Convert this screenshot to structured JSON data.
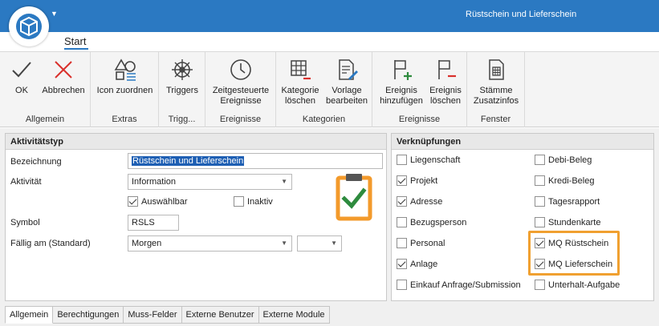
{
  "window": {
    "title": "Rüstschein und Lieferschein"
  },
  "ribbon": {
    "tab": "Start",
    "groups": [
      {
        "label": "Allgemein",
        "buttons": [
          {
            "label": "OK"
          },
          {
            "label": "Abbrechen"
          }
        ]
      },
      {
        "label": "Extras",
        "buttons": [
          {
            "label": "Icon zuordnen"
          }
        ]
      },
      {
        "label": "Trigg...",
        "buttons": [
          {
            "label": "Triggers"
          }
        ]
      },
      {
        "label": "Ereignisse",
        "buttons": [
          {
            "label1": "Zeitgesteuerte",
            "label2": "Ereignisse"
          }
        ]
      },
      {
        "label": "Kategorien",
        "buttons": [
          {
            "label1": "Kategorie",
            "label2": "löschen"
          },
          {
            "label1": "Vorlage",
            "label2": "bearbeiten"
          }
        ]
      },
      {
        "label": "Ereignisse",
        "buttons": [
          {
            "label1": "Ereignis",
            "label2": "hinzufügen"
          },
          {
            "label1": "Ereignis",
            "label2": "löschen"
          }
        ]
      },
      {
        "label": "Fenster",
        "buttons": [
          {
            "label1": "Stämme",
            "label2": "Zusatzinfos"
          }
        ]
      }
    ]
  },
  "aktivitaetstyp": {
    "header": "Aktivitätstyp",
    "bezeichnung_label": "Bezeichnung",
    "bezeichnung_value": "Rüstschein und Lieferschein",
    "aktivitaet_label": "Aktivität",
    "aktivitaet_value": "Information",
    "auswaehlbar_label": "Auswählbar",
    "inaktiv_label": "Inaktiv",
    "symbol_label": "Symbol",
    "symbol_value": "RSLS",
    "faellig_label": "Fällig am (Standard)",
    "faellig_value": "Morgen",
    "faellig_value2": ""
  },
  "verknuepfungen": {
    "header": "Verknüpfungen",
    "left": [
      {
        "label": "Liegenschaft",
        "checked": false
      },
      {
        "label": "Projekt",
        "checked": true
      },
      {
        "label": "Adresse",
        "checked": true
      },
      {
        "label": "Bezugsperson",
        "checked": false
      },
      {
        "label": "Personal",
        "checked": false
      },
      {
        "label": "Anlage",
        "checked": true
      },
      {
        "label": "Einkauf Anfrage/Submission",
        "checked": false
      }
    ],
    "right": [
      {
        "label": "Debi-Beleg",
        "checked": false
      },
      {
        "label": "Kredi-Beleg",
        "checked": false
      },
      {
        "label": "Tagesrapport",
        "checked": false
      },
      {
        "label": "Stundenkarte",
        "checked": false
      },
      {
        "label": "MQ Rüstschein",
        "checked": true
      },
      {
        "label": "MQ Lieferschein",
        "checked": true
      },
      {
        "label": "Unterhalt-Aufgabe",
        "checked": false
      }
    ]
  },
  "bottom_tabs": [
    "Allgemein",
    "Berechtigungen",
    "Muss-Felder",
    "Externe Benutzer",
    "Externe Module"
  ],
  "colors": {
    "titlebar": "#2b79c2",
    "highlight": "#f0a030",
    "clipboard": "#f39a2b",
    "check": "#2e8b3e"
  }
}
